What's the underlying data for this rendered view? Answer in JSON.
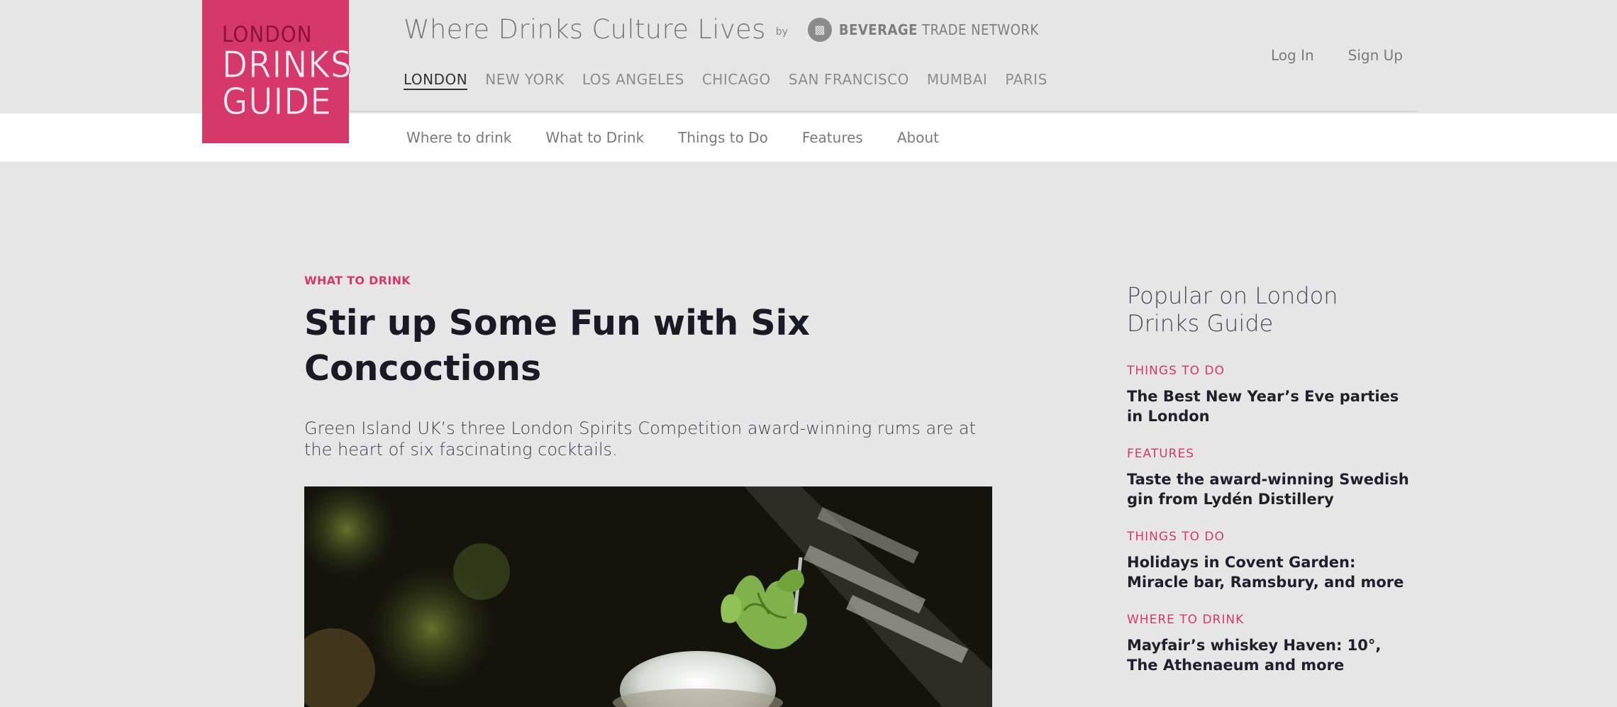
{
  "logo": {
    "line1": "LONDON",
    "line2": "DRINKS",
    "line3": "GUIDE",
    "color": "#d7386a"
  },
  "header": {
    "tagline": "Where Drinks Culture Lives",
    "by": "by",
    "partner_icon": "bottle-badge-icon",
    "partner_bold": "BEVERAGE",
    "partner_rest": "TRADE NETWORK",
    "cities": [
      "LONDON",
      "NEW YORK",
      "LOS ANGELES",
      "CHICAGO",
      "SAN FRANCISCO",
      "MUMBAI",
      "PARIS"
    ],
    "active_city": "LONDON",
    "login": "Log In",
    "signup": "Sign Up"
  },
  "subnav": [
    "Where to drink",
    "What to Drink",
    "Things to Do",
    "Features",
    "About"
  ],
  "article": {
    "category": "WHAT TO DRINK",
    "title": "Stir up Some Fun with Six Concoctions",
    "subtitle": "Green Island UK’s three London Spirits Competition award-winning rums are at the heart of six fascinating cocktails.",
    "hero_image": "cocktail-with-mint-garnish"
  },
  "sidebar": {
    "title": "Popular on London Drinks Guide",
    "items": [
      {
        "category": "THINGS TO DO",
        "headline": "The Best New Year’s Eve parties in London"
      },
      {
        "category": "FEATURES",
        "headline": "Taste the award-winning Swedish gin from Lydén Distillery"
      },
      {
        "category": "THINGS TO DO",
        "headline": "Holidays in Covent Garden: Miracle bar, Ramsbury, and more"
      },
      {
        "category": "WHERE TO DRINK",
        "headline": "Mayfair’s whiskey Haven: 10°, The Athenaeum and more"
      }
    ]
  },
  "colors": {
    "accent": "#d7386a",
    "background": "#e6e6e6",
    "subnav_bg": "#ffffff"
  }
}
